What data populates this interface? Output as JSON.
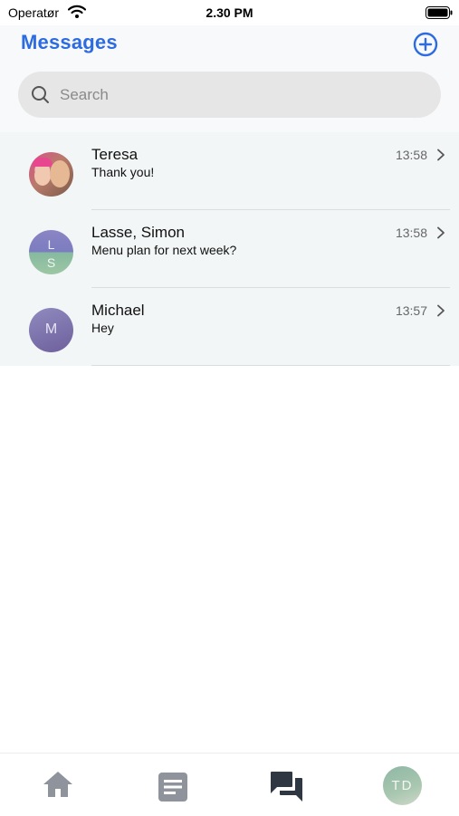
{
  "status_bar": {
    "carrier": "Operatør",
    "time": "2.30 PM"
  },
  "header": {
    "title": "Messages",
    "compose_icon": "plus-circle-icon"
  },
  "search": {
    "placeholder": "Search",
    "value": ""
  },
  "conversations": [
    {
      "sender": "Teresa",
      "preview": "Thank you!",
      "time": "13:58",
      "avatar_type": "photo"
    },
    {
      "sender": "Lasse, Simon",
      "preview": "Menu plan for next week?",
      "time": "13:58",
      "avatar_type": "split",
      "initials": [
        "L",
        "S"
      ]
    },
    {
      "sender": "Michael",
      "preview": "Hey",
      "time": "13:57",
      "avatar_type": "initial",
      "initials": [
        "M"
      ]
    }
  ],
  "tab_bar": {
    "tabs": [
      {
        "icon": "home-icon",
        "active": false
      },
      {
        "icon": "document-icon",
        "active": false
      },
      {
        "icon": "chat-icon",
        "active": true
      },
      {
        "icon": "profile-avatar",
        "active": false,
        "initials": "TD"
      }
    ]
  },
  "colors": {
    "accent": "#2d6be0",
    "list_background": "#f3f6f7",
    "tab_inactive": "#8e939c",
    "tab_active": "#2f3742"
  }
}
